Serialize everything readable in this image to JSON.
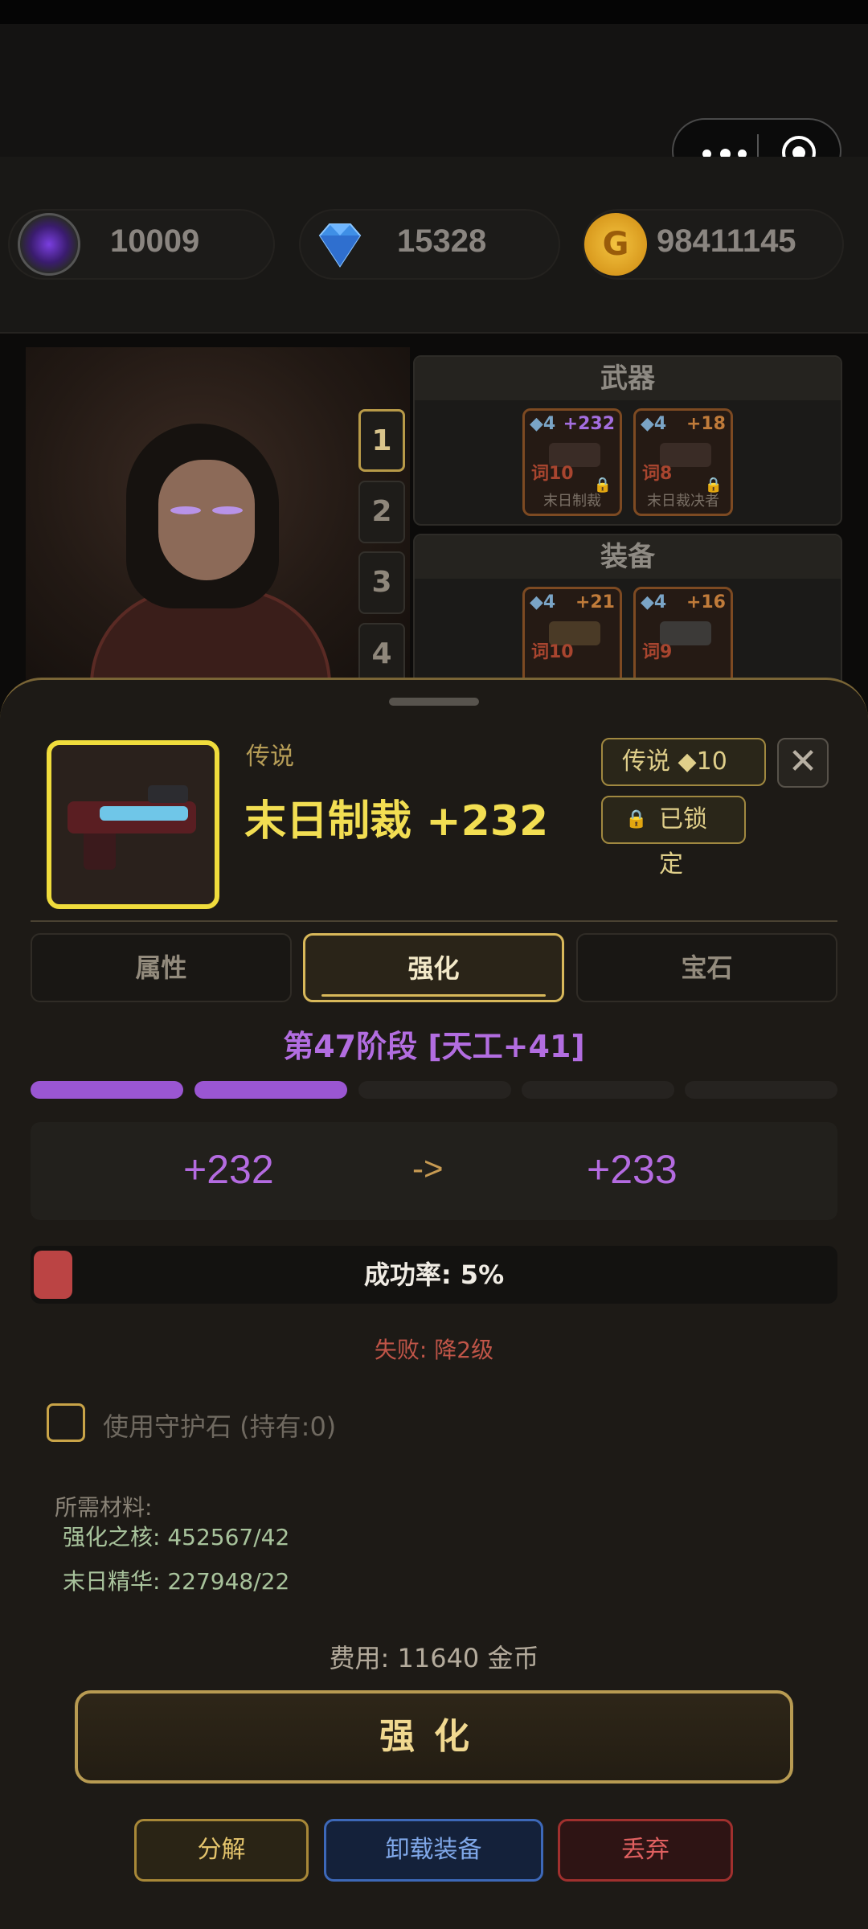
{
  "currencies": [
    {
      "icon": "purple-orb-icon",
      "value": "10009"
    },
    {
      "icon": "diamond-icon",
      "value": "15328"
    },
    {
      "icon": "gold-coin-icon",
      "value": "98411145",
      "symbol": "G"
    }
  ],
  "slots": [
    "1",
    "2",
    "3",
    "4"
  ],
  "weapons_panel": {
    "title": "武器",
    "cards": [
      {
        "tier": "◆4",
        "bonus": "+232",
        "bonus_color": "#a46ee0",
        "affix": "词10",
        "name": "末日制裁",
        "locked": true
      },
      {
        "tier": "◆4",
        "bonus": "+18",
        "bonus_color": "#c07b3a",
        "affix": "词8",
        "name": "末日裁决者",
        "locked": true
      }
    ]
  },
  "equipment_panel": {
    "title": "装备",
    "cards": [
      {
        "tier": "◆4",
        "bonus": "+21",
        "bonus_color": "#c07b3a",
        "affix": "词10"
      },
      {
        "tier": "◆4",
        "bonus": "+16",
        "bonus_color": "#c07b3a",
        "affix": "词9"
      }
    ]
  },
  "item": {
    "rarity": "传说",
    "name": "末日制裁 +232",
    "rarity_badge": "传说 ◆10",
    "lock_badge": "已锁定",
    "close": "✕"
  },
  "tabs": [
    {
      "label": "属性",
      "active": false
    },
    {
      "label": "强化",
      "active": true
    },
    {
      "label": "宝石",
      "active": false
    }
  ],
  "enhance": {
    "stage": "第47阶段 [天工+41]",
    "progress_segments_filled": 2,
    "progress_segments_total": 5,
    "from": "+232",
    "arrow": "->",
    "to": "+233",
    "success_rate_label": "成功率: 5%",
    "success_rate": 0.05,
    "fail_text": "失败: 降2级",
    "guard_label": "使用守护石 (持有:0)",
    "guard_checked": false,
    "materials_title": "所需材料:",
    "materials": [
      "强化之核: 452567/42",
      "末日精华: 227948/22"
    ],
    "cost": "费用: 11640 金币",
    "button": "强化"
  },
  "actions": {
    "decompose": "分解",
    "unequip": "卸载装备",
    "discard": "丢弃"
  },
  "colors": {
    "accent_gold": "#d8b85a",
    "purple": "#b46be0",
    "rate_red": "#bb4444"
  }
}
